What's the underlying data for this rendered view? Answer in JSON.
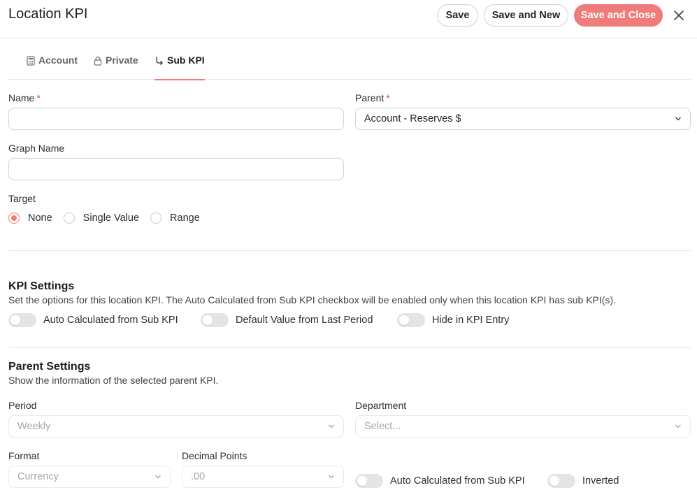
{
  "header": {
    "title": "Location KPI",
    "save_label": "Save",
    "save_new_label": "Save and New",
    "save_close_label": "Save and Close"
  },
  "tabs": [
    {
      "label": "Account",
      "icon": "calculator-icon"
    },
    {
      "label": "Private",
      "icon": "lock-icon"
    },
    {
      "label": "Sub KPI",
      "icon": "branch-arrow-icon",
      "active": true
    }
  ],
  "form": {
    "name_label": "Name",
    "name_value": "",
    "parent_label": "Parent",
    "parent_value": "Account - Reserves $",
    "graph_name_label": "Graph Name",
    "graph_name_value": "",
    "target_label": "Target",
    "target_options": [
      "None",
      "Single Value",
      "Range"
    ],
    "target_selected": "None",
    "required_mark": "*"
  },
  "kpi_settings": {
    "title": "KPI Settings",
    "description": "Set the options for this location KPI. The Auto Calculated from Sub KPI checkbox will be enabled only when this location KPI has sub KPI(s).",
    "toggles": [
      {
        "label": "Auto Calculated from Sub KPI",
        "on": false
      },
      {
        "label": "Default Value from Last Period",
        "on": false
      },
      {
        "label": "Hide in KPI Entry",
        "on": false
      }
    ]
  },
  "parent_settings": {
    "title": "Parent Settings",
    "description": "Show the information of the selected parent KPI.",
    "period_label": "Period",
    "period_value": "Weekly",
    "department_label": "Department",
    "department_placeholder": "Select...",
    "format_label": "Format",
    "format_value": "Currency",
    "decimal_label": "Decimal Points",
    "decimal_value": ".00",
    "toggles": [
      {
        "label": "Auto Calculated from Sub KPI",
        "on": false
      },
      {
        "label": "Inverted",
        "on": false
      }
    ]
  },
  "colors": {
    "accent": "#ef7b7b",
    "border": "#cfd2d7",
    "required": "#e04848"
  }
}
